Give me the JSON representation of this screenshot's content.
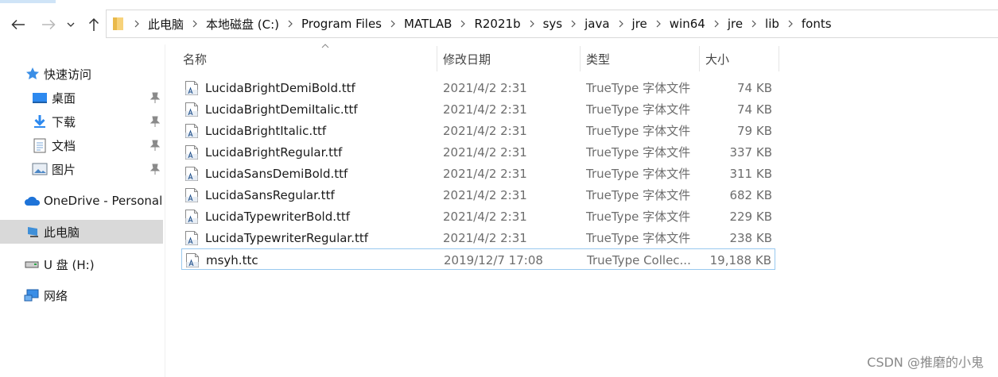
{
  "toolbar": {
    "back": "back-arrow-icon",
    "forward": "forward-arrow-icon",
    "recent": "chevron-down-icon",
    "up": "up-arrow-icon"
  },
  "address_bar": {
    "crumbs": [
      "此电脑",
      "本地磁盘 (C:)",
      "Program Files",
      "MATLAB",
      "R2021b",
      "sys",
      "java",
      "jre",
      "win64",
      "jre",
      "lib",
      "fonts"
    ]
  },
  "sidebar": {
    "quick_access": "快速访问",
    "items": [
      {
        "label": "桌面",
        "icon": "desktop-icon",
        "pinned": true
      },
      {
        "label": "下载",
        "icon": "download-icon",
        "pinned": true
      },
      {
        "label": "文档",
        "icon": "document-icon",
        "pinned": true
      },
      {
        "label": "图片",
        "icon": "pictures-icon",
        "pinned": true
      }
    ],
    "onedrive": "OneDrive - Personal",
    "this_pc": "此电脑",
    "usb": "U 盘 (H:)",
    "network": "网络"
  },
  "columns": {
    "name": "名称",
    "date": "修改日期",
    "type": "类型",
    "size": "大小"
  },
  "files": [
    {
      "name": "LucidaBrightDemiBold.ttf",
      "date": "2021/4/2 2:31",
      "type": "TrueType 字体文件",
      "size": "74 KB"
    },
    {
      "name": "LucidaBrightDemiItalic.ttf",
      "date": "2021/4/2 2:31",
      "type": "TrueType 字体文件",
      "size": "74 KB"
    },
    {
      "name": "LucidaBrightItalic.ttf",
      "date": "2021/4/2 2:31",
      "type": "TrueType 字体文件",
      "size": "79 KB"
    },
    {
      "name": "LucidaBrightRegular.ttf",
      "date": "2021/4/2 2:31",
      "type": "TrueType 字体文件",
      "size": "337 KB"
    },
    {
      "name": "LucidaSansDemiBold.ttf",
      "date": "2021/4/2 2:31",
      "type": "TrueType 字体文件",
      "size": "311 KB"
    },
    {
      "name": "LucidaSansRegular.ttf",
      "date": "2021/4/2 2:31",
      "type": "TrueType 字体文件",
      "size": "682 KB"
    },
    {
      "name": "LucidaTypewriterBold.ttf",
      "date": "2021/4/2 2:31",
      "type": "TrueType 字体文件",
      "size": "229 KB"
    },
    {
      "name": "LucidaTypewriterRegular.ttf",
      "date": "2021/4/2 2:31",
      "type": "TrueType 字体文件",
      "size": "238 KB"
    },
    {
      "name": "msyh.ttc",
      "date": "2019/12/7 17:08",
      "type": "TrueType Collec...",
      "size": "19,188 KB",
      "selected": true
    }
  ],
  "watermark": "CSDN @推磨的小鬼",
  "colors": {
    "selection_border": "#99c9ef",
    "nav_selected_bg": "#d9d9d9",
    "secondary_text": "#6d6d6d"
  }
}
